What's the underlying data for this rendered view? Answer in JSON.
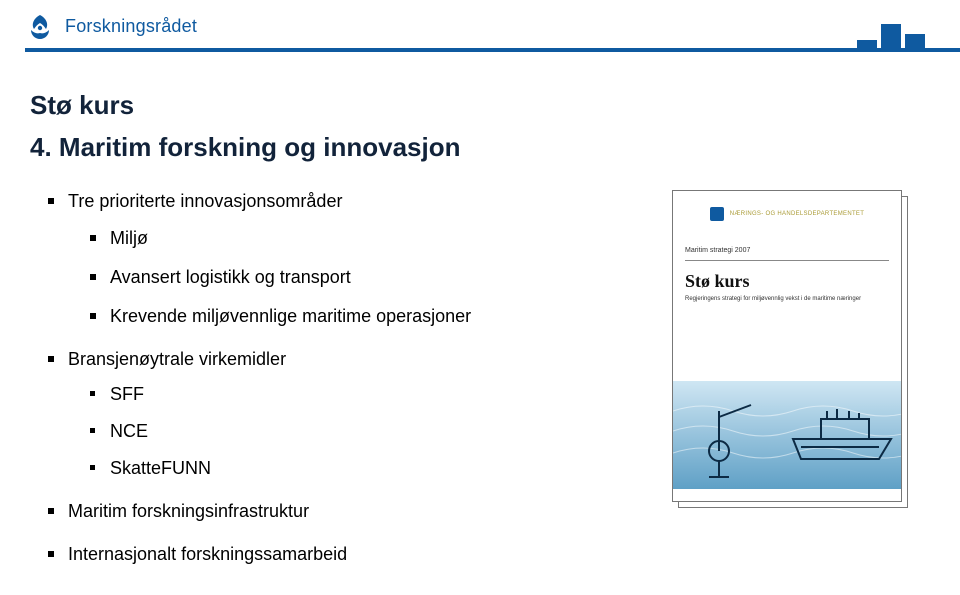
{
  "header": {
    "brand": "Forskningsrådet"
  },
  "titles": {
    "overtitle": "Stø kurs",
    "main": "4. Maritim forskning og innovasjon"
  },
  "bullets": {
    "l1": [
      {
        "text": "Tre prioriterte innovasjonsområder",
        "children": [
          {
            "text": "Miljø"
          },
          {
            "text": "Avansert logistikk og transport"
          },
          {
            "text": "Krevende miljøvennlige maritime operasjoner"
          }
        ]
      },
      {
        "text": "Bransjenøytrale virkemidler",
        "children": [
          {
            "text": "SFF"
          },
          {
            "text": "NCE"
          },
          {
            "text": "SkatteFUNN"
          }
        ]
      },
      {
        "text": "Maritim forskningsinfrastruktur"
      },
      {
        "text": "Internasjonalt forskningssamarbeid"
      }
    ]
  },
  "document_preview": {
    "ministry_line": "NÆRINGS- OG HANDELSDEPARTEMENTET",
    "small_label": "Maritim strategi 2007",
    "title": "Stø kurs",
    "subtitle": "Regjeringens strategi for miljøvennlig vekst i de maritime næringer"
  }
}
